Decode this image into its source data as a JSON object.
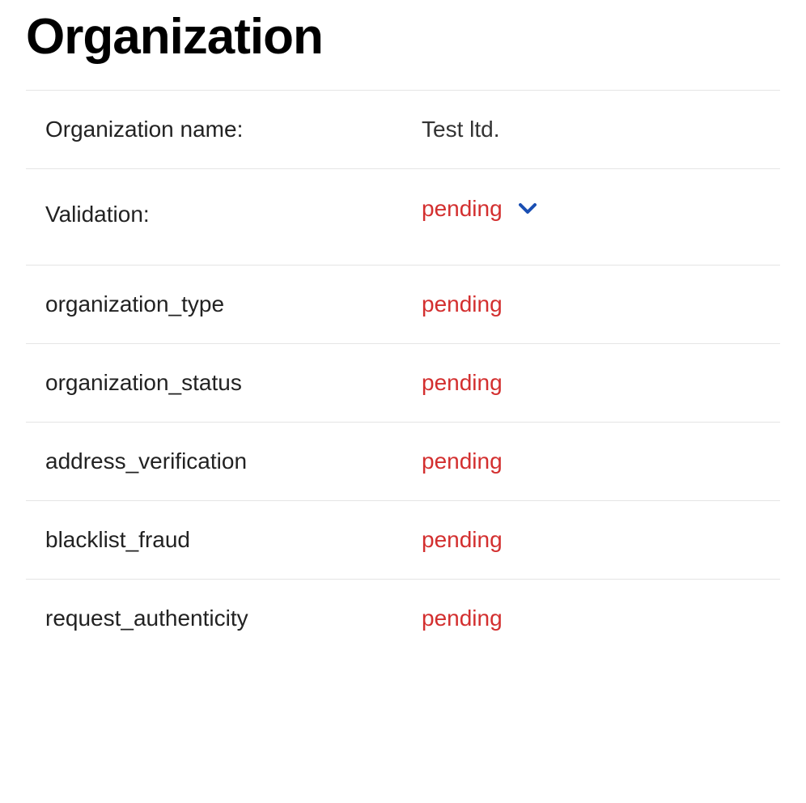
{
  "page": {
    "title": "Organization"
  },
  "details": {
    "name_label": "Organization name:",
    "name_value": "Test ltd.",
    "validation_label": "Validation:",
    "validation_value": "pending"
  },
  "checks": [
    {
      "label": "organization_type",
      "status": "pending"
    },
    {
      "label": "organization_status",
      "status": "pending"
    },
    {
      "label": "address_verification",
      "status": "pending"
    },
    {
      "label": "blacklist_fraud",
      "status": "pending"
    },
    {
      "label": "request_authenticity",
      "status": "pending"
    }
  ]
}
